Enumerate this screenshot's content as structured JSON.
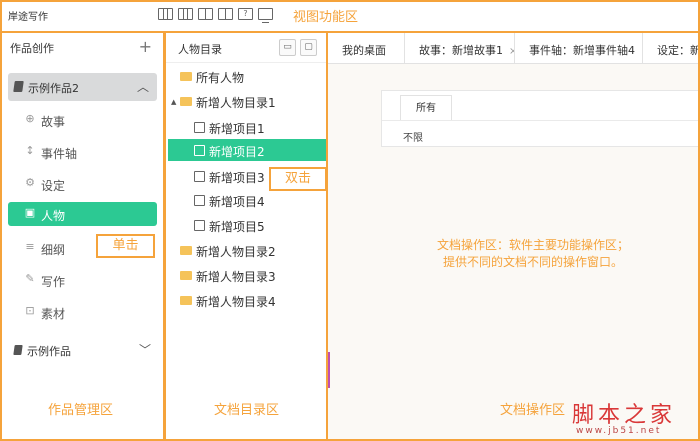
{
  "app": {
    "title": "岸途写作"
  },
  "view_toolbar": {
    "icons": [
      "three-column-icon",
      "three-column-icon",
      "two-column-icon",
      "two-column-icon",
      "help-icon",
      "monitor-icon"
    ],
    "help_glyph": "?",
    "annotation": "视图功能区"
  },
  "left_panel": {
    "title": "作品创作",
    "add_glyph": "+",
    "work": {
      "name": "示例作品2",
      "chevron": "︿"
    },
    "menu": [
      {
        "label": "故事",
        "icon": "story-icon",
        "glyph": "⊕"
      },
      {
        "label": "事件轴",
        "icon": "timeline-icon",
        "glyph": "↕"
      },
      {
        "label": "设定",
        "icon": "settings-icon",
        "glyph": "⚙"
      },
      {
        "label": "人物",
        "icon": "person-card-icon",
        "glyph": "▣"
      },
      {
        "label": "细纲",
        "icon": "outline-list-icon",
        "glyph": "≡"
      },
      {
        "label": "写作",
        "icon": "pen-icon",
        "glyph": "✎"
      },
      {
        "label": "素材",
        "icon": "material-icon",
        "glyph": "⊡"
      }
    ],
    "work2": {
      "name": "示例作品",
      "chevron": "﹀"
    },
    "annotation_click": "单击",
    "annotation_area": "作品管理区"
  },
  "middle_panel": {
    "title": "人物目录",
    "btn_new_folder": "▭",
    "btn_new_file": "▢",
    "tree": [
      {
        "label": "所有人物",
        "type": "folder",
        "level": 0
      },
      {
        "label": "新增人物目录1",
        "type": "folder",
        "level": 0,
        "expanded": true
      },
      {
        "label": "新增项目1",
        "type": "file",
        "level": 1
      },
      {
        "label": "新增项目2",
        "type": "file",
        "level": 1,
        "selected": true
      },
      {
        "label": "新增项目3",
        "type": "file",
        "level": 1
      },
      {
        "label": "新增项目4",
        "type": "file",
        "level": 1
      },
      {
        "label": "新增项目5",
        "type": "file",
        "level": 1
      },
      {
        "label": "新增人物目录2",
        "type": "folder",
        "level": 0
      },
      {
        "label": "新增人物目录3",
        "type": "folder",
        "level": 0
      },
      {
        "label": "新增人物目录4",
        "type": "folder",
        "level": 0
      }
    ],
    "expand_glyph": "▲",
    "annotation_dblclick": "双击",
    "annotation_area": "文档目录区"
  },
  "right_panel": {
    "tabs": [
      {
        "label": "我的桌面",
        "closable": false
      },
      {
        "label": "故事：新增故事1",
        "closable": true
      },
      {
        "label": "事件轴：新增事件轴4",
        "closable": true
      },
      {
        "label": "设定：新增",
        "closable": false
      }
    ],
    "close_glyph": "×",
    "filter": {
      "tab": "所有",
      "value": "不限"
    },
    "description": [
      "文档操作区：软件主要功能操作区；",
      "提供不同的文档不同的操作窗口。"
    ],
    "annotation_area": "文档操作区"
  },
  "watermark": {
    "text": "脚本之家",
    "url": "www.jb51.net"
  },
  "colors": {
    "accent": "#2cc993",
    "annotation": "#f5a33b",
    "watermark": "#d93838"
  }
}
